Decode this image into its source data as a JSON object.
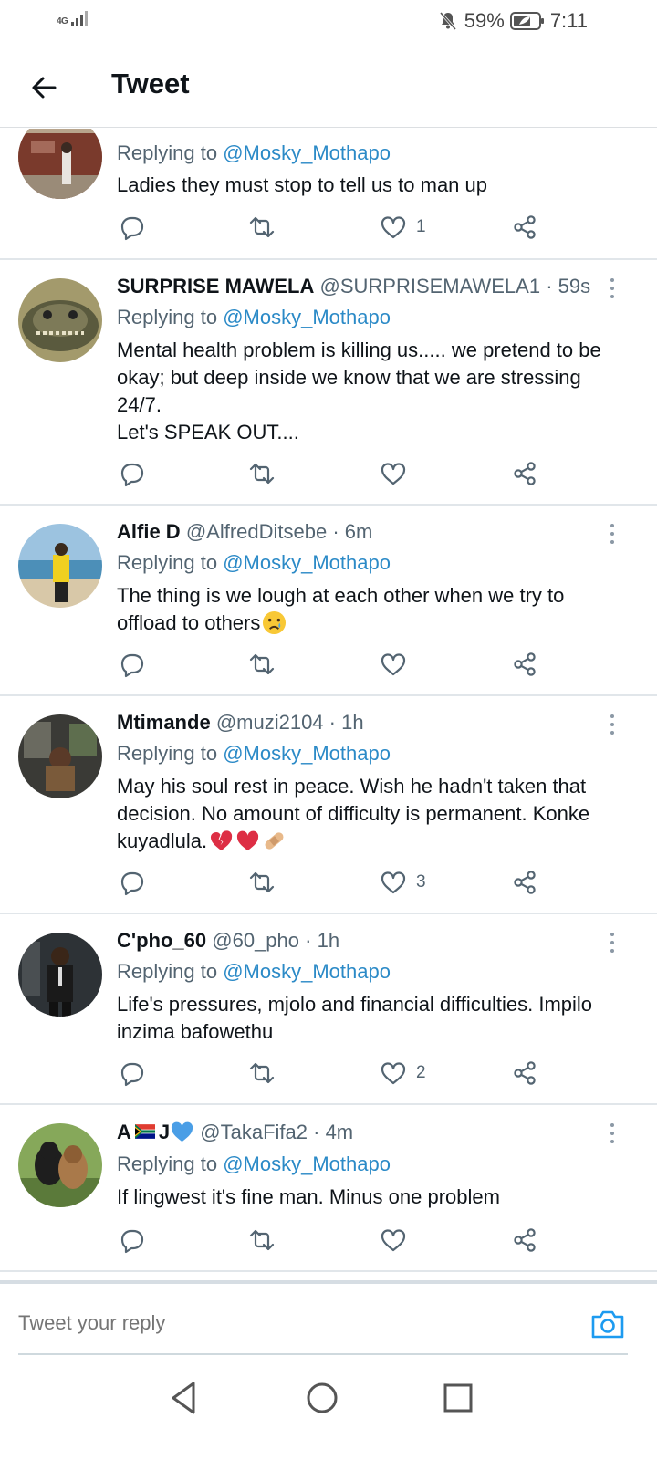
{
  "status_bar": {
    "network": "4G",
    "battery": "59%",
    "time": "7:11"
  },
  "header": {
    "title": "Tweet"
  },
  "replying_label": "Replying to",
  "replying_to": "@Mosky_Mothapo",
  "tweets": [
    {
      "name": "",
      "handle": "",
      "time": "",
      "text": [
        "Ladies they must stop to tell us to man up"
      ],
      "counts": {
        "reply": "",
        "retweet": "",
        "like": "1"
      },
      "avatar_color": "#7a3a2c"
    },
    {
      "name": "SURPRISE MAWELA",
      "handle": "@SURPRISEMAWELA1",
      "time": "59s",
      "text": [
        "Mental health problem is killing us..... we pretend to be okay; but deep inside we know that we are stressing 24/7.",
        "Let's SPEAK OUT...."
      ],
      "counts": {
        "reply": "",
        "retweet": "",
        "like": ""
      },
      "avatar_color": "#6b6a4a"
    },
    {
      "name": "Alfie D",
      "handle": "@AlfredDitsebe",
      "time": "6m",
      "text": [
        "The thing is we lough at each other when we try to offload to others"
      ],
      "emoji": [
        "crying-face-emoji"
      ],
      "counts": {
        "reply": "",
        "retweet": "",
        "like": ""
      },
      "avatar_color": "#6da3c6"
    },
    {
      "name": "Mtimande",
      "handle": "@muzi2104",
      "time": "1h",
      "text": [
        "May his soul rest in peace. Wish he hadn't taken that decision. No amount of difficulty is permanent. Konke kuyadlula."
      ],
      "emoji": [
        "broken-heart-emoji",
        "red-heart-emoji",
        "bandage-emoji"
      ],
      "counts": {
        "reply": "",
        "retweet": "",
        "like": "3"
      },
      "avatar_color": "#3a3a36"
    },
    {
      "name": "C'pho_60",
      "handle": "@60_pho",
      "time": "1h",
      "text": [
        "Life's pressures, mjolo and financial difficulties. Impilo inzima bafowethu"
      ],
      "counts": {
        "reply": "",
        "retweet": "",
        "like": "2"
      },
      "avatar_color": "#2d3236"
    },
    {
      "name": "A",
      "name_suffix": "J",
      "name_emoji": [
        "south-africa-flag-emoji",
        "blue-heart-emoji"
      ],
      "handle": "@TakaFifa2",
      "time": "4m",
      "text": [
        "If lingwest it's fine man. Minus one problem"
      ],
      "counts": {
        "reply": "",
        "retweet": "",
        "like": ""
      },
      "avatar_color": "#5b7a3a"
    }
  ],
  "reply_bar": {
    "placeholder": "Tweet your reply"
  },
  "colors": {
    "accent": "#1d9bf0",
    "mention": "#2b8ac7",
    "secondary_text": "#536471",
    "divider": "#e1e6ea"
  }
}
